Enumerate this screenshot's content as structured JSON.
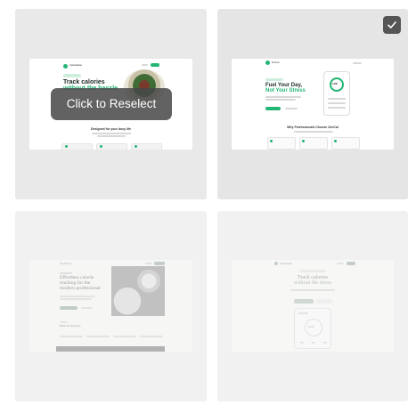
{
  "tiles": [
    {
      "brand": "CalorieEase",
      "badge": "Simple calorie tracking",
      "headline_1": "Track calories",
      "headline_2": "without the hassle",
      "section_title": "Designed for your busy life",
      "overlay_label": "Click to Reselect",
      "selected": false
    },
    {
      "brand": "ZenCal",
      "headline_1": "Fuel Your Day,",
      "headline_2": "Not Your Stress",
      "ring_value": "1,280",
      "section_title": "Why Professionals Choose ZenCal",
      "selected": true
    },
    {
      "brand": "NourishLog",
      "headline_1": "Effortless calorie",
      "headline_2": "tracking for the",
      "headline_3": "modern professional",
      "section_title": "Built for the flow",
      "selected": false
    },
    {
      "brand": "CalorieEase",
      "headline_1": "Track calories",
      "headline_2": "without the stress",
      "ring_value": "2,070",
      "selected": false
    }
  ],
  "colors": {
    "accent": "#22b573",
    "overlay": "#464646",
    "check_bg": "#555555"
  }
}
